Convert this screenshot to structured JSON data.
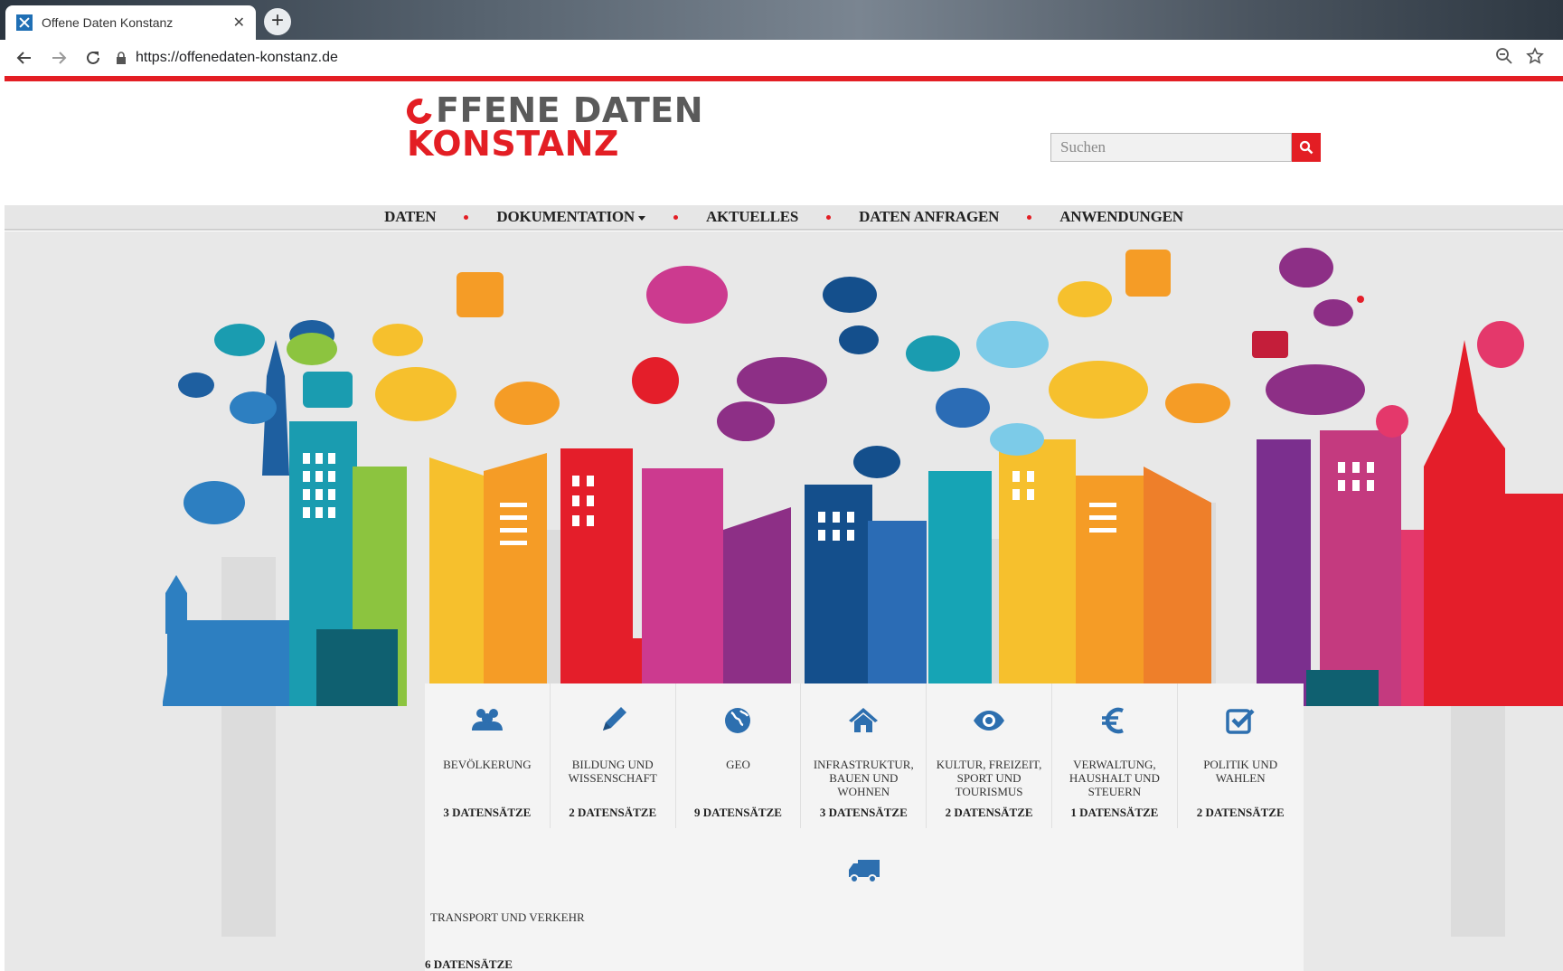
{
  "browser": {
    "tab_title": "Offene Daten Konstanz",
    "url": "https://offenedaten-konstanz.de"
  },
  "site": {
    "logo_line1": "FFENE DATEN",
    "logo_line2": "KONSTANZ",
    "search_placeholder": "Suchen",
    "accent_color": "#e31e24"
  },
  "nav": {
    "items": [
      {
        "label": "DATEN"
      },
      {
        "label": "DOKUMENTATION"
      },
      {
        "label": "AKTUELLES"
      },
      {
        "label": "DATEN ANFRAGEN"
      },
      {
        "label": "ANWENDUNGEN"
      }
    ]
  },
  "categories": [
    {
      "name": "BEVÖLKERUNG",
      "count": "3 DATENSÄTZE",
      "icon": "users-icon"
    },
    {
      "name": "BILDUNG UND WISSENSCHAFT",
      "count": "2 DATENSÄTZE",
      "icon": "pencil-icon"
    },
    {
      "name": "GEO",
      "count": "9 DATENSÄTZE",
      "icon": "globe-icon"
    },
    {
      "name": "INFRASTRUKTUR, BAUEN UND WOHNEN",
      "count": "3 DATENSÄTZE",
      "icon": "home-icon"
    },
    {
      "name": "KULTUR, FREIZEIT, SPORT UND TOURISMUS",
      "count": "2 DATENSÄTZE",
      "icon": "eye-icon"
    },
    {
      "name": "VERWALTUNG, HAUSHALT UND STEUERN",
      "count": "1 DATENSÄTZE",
      "icon": "euro-icon"
    },
    {
      "name": "POLITIK UND WAHLEN",
      "count": "2 DATENSÄTZE",
      "icon": "checkbox-icon"
    },
    {
      "name": "TRANSPORT UND VERKEHR",
      "count": "6 DATENSÄTZE",
      "icon": "truck-icon"
    }
  ]
}
